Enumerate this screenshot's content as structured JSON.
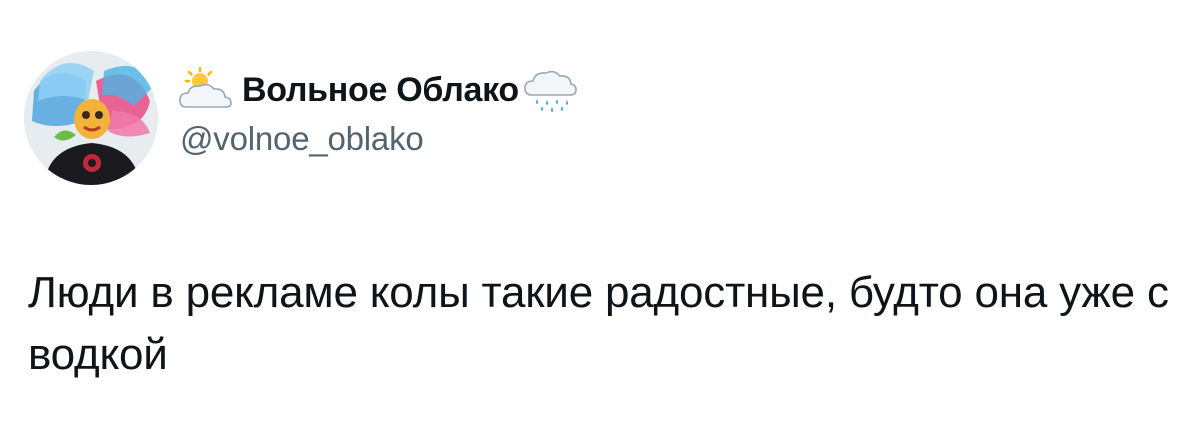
{
  "author": {
    "display_name": "Вольное Облако",
    "handle": "@volnoe_oblako",
    "name_prefix_emoji": "sun-behind-cloud-icon",
    "name_suffix_emoji": "cloud-with-rain-icon"
  },
  "tweet": {
    "text": "Люди в рекламе колы такие радостные, будто она уже с водкой"
  },
  "colors": {
    "text_primary": "#0f1419",
    "text_secondary": "#536471",
    "background": "#ffffff"
  }
}
